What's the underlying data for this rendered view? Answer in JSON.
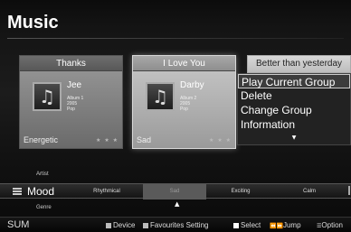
{
  "app": {
    "title": "Music"
  },
  "cards": [
    {
      "title": "Thanks",
      "artist": "Jee",
      "album": "Album 1",
      "year": "2005",
      "genre": "Pop",
      "mood": "Energetic",
      "stars": "★ ★ ★",
      "selected": false
    },
    {
      "title": "I Love You",
      "artist": "Darby",
      "album": "Album 2",
      "year": "2005",
      "genre": "Pop",
      "mood": "Sad",
      "stars": "★ ★ ★",
      "selected": true
    },
    {
      "title": "Better than yesterday"
    }
  ],
  "context_menu": {
    "items": [
      "Play Current Group",
      "Delete",
      "Change Group",
      "Information"
    ],
    "more_glyph": "▼"
  },
  "category_bar": {
    "above_label": "Artist",
    "current": "Mood",
    "below_label": "Genre",
    "options": [
      "Rhythmical",
      "Sad",
      "Exciting",
      "Calm"
    ],
    "selected_option": "Sad",
    "up_glyph": "▲"
  },
  "footer": {
    "sum": "SUM",
    "hints": [
      {
        "label": "Device",
        "icon": "gray-square-icon"
      },
      {
        "label": "Favourites Setting",
        "icon": "gray-square-icon"
      },
      {
        "label": "Select",
        "icon": "white-square-icon"
      },
      {
        "label": "Jump",
        "icon": "jump-keys-icon"
      },
      {
        "label": "Option",
        "icon": "option-key-icon"
      }
    ]
  },
  "colors": {
    "background": "#141414",
    "card": "#888888",
    "card_selected": "#bfbfbf",
    "menu_bg": "#222222"
  }
}
